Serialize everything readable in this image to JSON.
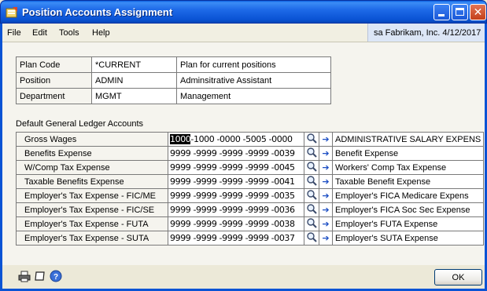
{
  "window": {
    "title": "Position Accounts Assignment"
  },
  "menu": {
    "items": [
      "File",
      "Edit",
      "Tools",
      "Help"
    ]
  },
  "user_info": "sa  Fabrikam, Inc.  4/12/2017",
  "info": [
    {
      "label": "Plan Code",
      "value": "*CURRENT",
      "description": "Plan for current positions"
    },
    {
      "label": "Position",
      "value": "ADMIN",
      "description": "Adminsitrative Assistant"
    },
    {
      "label": "Department",
      "value": "MGMT",
      "description": "Management"
    }
  ],
  "gl_heading": "Default General Ledger Accounts",
  "gl_accounts": [
    {
      "label": "Gross Wages",
      "account_highlight": "1000",
      "account_rest": "-1000 -0000 -5005 -0000",
      "description": "ADMINISTRATIVE SALARY EXPENS"
    },
    {
      "label": "Benefits Expense",
      "account_highlight": "",
      "account_rest": "9999 -9999 -9999 -9999 -0039",
      "description": "Benefit Expense"
    },
    {
      "label": "W/Comp Tax Expense",
      "account_highlight": "",
      "account_rest": "9999 -9999 -9999 -9999 -0045",
      "description": "Workers' Comp Tax Expense"
    },
    {
      "label": "Taxable Benefits Expense",
      "account_highlight": "",
      "account_rest": "9999 -9999 -9999 -9999 -0041",
      "description": "Taxable Benefit Expense"
    },
    {
      "label": "Employer's Tax Expense - FIC/ME",
      "account_highlight": "",
      "account_rest": "9999 -9999 -9999 -9999 -0035",
      "description": "Employer's FICA Medicare Expens"
    },
    {
      "label": "Employer's Tax Expense - FIC/SE",
      "account_highlight": "",
      "account_rest": "9999 -9999 -9999 -9999 -0036",
      "description": "Employer's FICA Soc Sec Expense"
    },
    {
      "label": "Employer's Tax Expense - FUTA",
      "account_highlight": "",
      "account_rest": "9999 -9999 -9999 -9999 -0038",
      "description": "Employer's FUTA Expense"
    },
    {
      "label": "Employer's Tax Expense - SUTA",
      "account_highlight": "",
      "account_rest": "9999 -9999 -9999 -9999 -0037",
      "description": "Employer's SUTA Expense"
    }
  ],
  "ok_label": "OK",
  "icons": {
    "title": "window-app-icon",
    "lookup": "lookup-magnifier-icon",
    "expand": "expansion-arrow-icon",
    "print": "printer-icon",
    "note": "note-icon",
    "help": "help-icon"
  },
  "colors": {
    "titlebar": "#0A53D4",
    "highlight": "#000000",
    "arrow": "#1C4EC4"
  }
}
